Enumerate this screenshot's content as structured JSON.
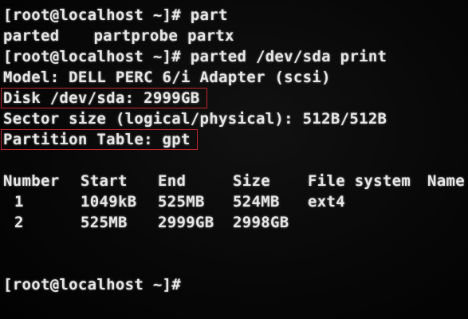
{
  "terminal": {
    "line1": "[root@localhost ~]# part",
    "completions": [
      "parted",
      "partprobe",
      "partx"
    ],
    "line3": "[root@localhost ~]# parted /dev/sda print",
    "model": "Model: DELL PERC 6/i Adapter (scsi)",
    "disk": "Disk /dev/sda: 2999GB",
    "sector": "Sector size (logical/physical): 512B/512B",
    "partition_table": "Partition Table: gpt",
    "headers": [
      "Number",
      "Start",
      "End",
      "Size",
      "File system",
      "Name"
    ],
    "rows": [
      [
        "1",
        "1049kB",
        "525MB",
        "524MB",
        "ext4"
      ],
      [
        "2",
        "525MB",
        "2999GB",
        "2998GB",
        ""
      ]
    ],
    "prompt": "[root@localhost ~]#"
  },
  "colors": {
    "background": "#050505",
    "text": "#e6e6e6",
    "highlight_box": "#c0262c"
  }
}
